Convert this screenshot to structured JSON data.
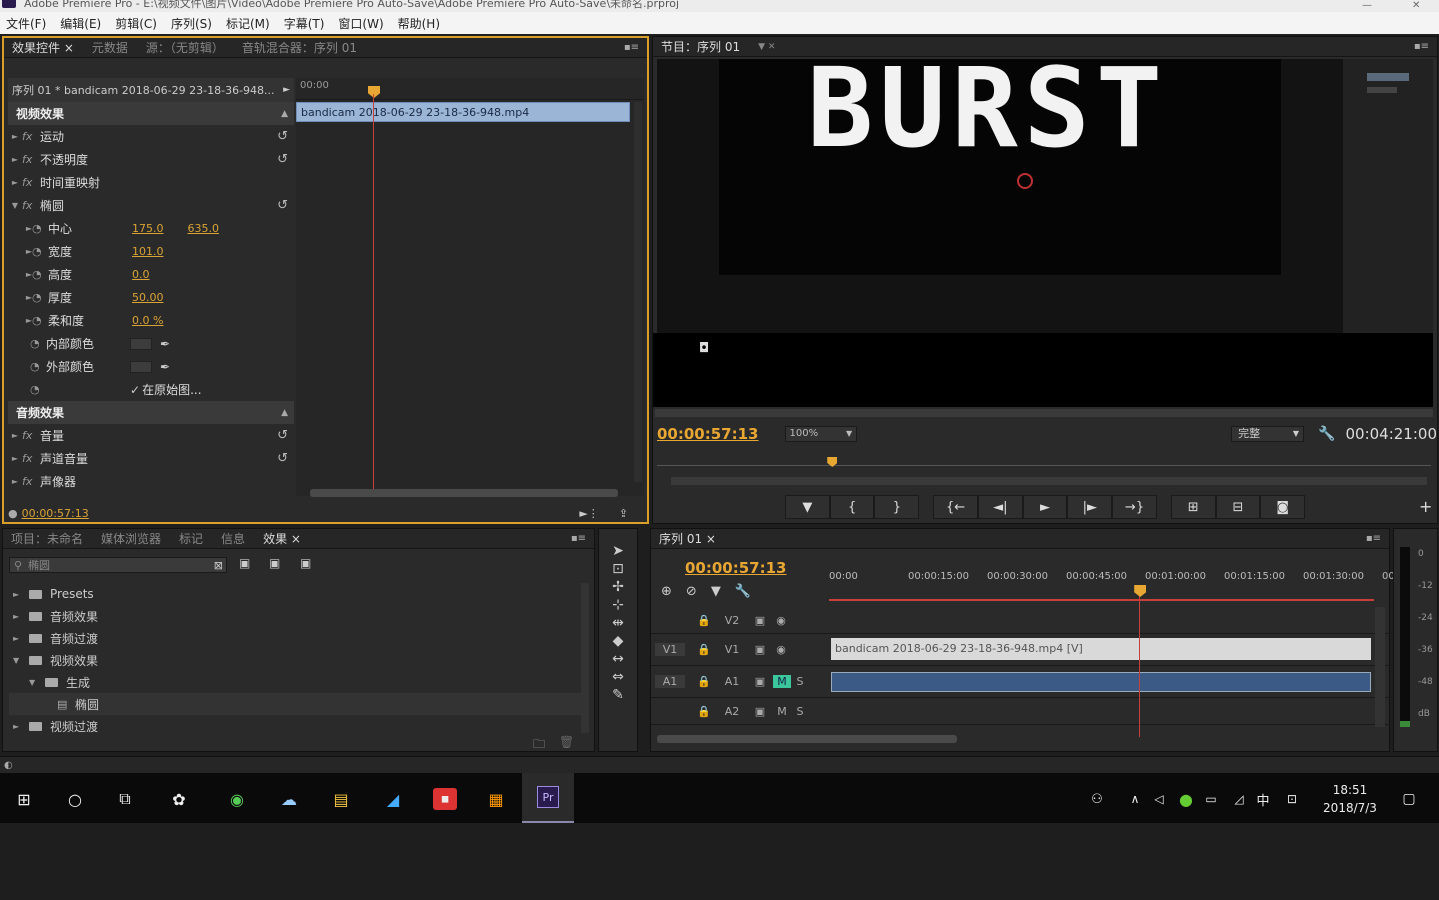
{
  "window": {
    "title": "Adobe Premiere Pro - E:\\视频文件\\图片\\Video\\Adobe Premiere Pro Auto-Save\\Adobe Premiere Pro Auto-Save\\未命名.prproj"
  },
  "menu": [
    "文件(F)",
    "编辑(E)",
    "剪辑(C)",
    "序列(S)",
    "标记(M)",
    "字幕(T)",
    "窗口(W)",
    "帮助(H)"
  ],
  "effect_controls": {
    "tabs": [
      "效果控件 ×",
      "元数据",
      "源：（无剪辑）",
      "音轨混合器：序列 01"
    ],
    "sequence_label": "序列 01 * bandicam 2018-06-29 23-18-36-948...",
    "timeline_start": "00:00",
    "clip_name": "bandicam 2018-06-29 23-18-36-948.mp4",
    "video_header": "视频效果",
    "video_effects": [
      {
        "name": "运动",
        "prefix": "fx",
        "hasReset": true
      },
      {
        "name": "不透明度",
        "prefix": "fx",
        "hasReset": true
      },
      {
        "name": "时间重映射",
        "prefix": "fx",
        "hasReset": false
      },
      {
        "name": "椭圆",
        "prefix": "fx",
        "hasReset": true,
        "expanded": true
      }
    ],
    "ellipse_props": [
      {
        "name": "中心",
        "v1": "175.0",
        "v2": "635.0"
      },
      {
        "name": "宽度",
        "v1": "101.0"
      },
      {
        "name": "高度",
        "v1": "0.0"
      },
      {
        "name": "厚度",
        "v1": "50.00"
      },
      {
        "name": "柔和度",
        "v1": "0.0 %"
      },
      {
        "name": "内部颜色",
        "color": true
      },
      {
        "name": "外部颜色",
        "color": true
      },
      {
        "name": "",
        "check": "在原始图..."
      }
    ],
    "audio_header": "音频效果",
    "audio_effects": [
      {
        "name": "音量",
        "hasReset": true
      },
      {
        "name": "声道音量",
        "hasReset": true
      },
      {
        "name": "声像器",
        "hasReset": false
      }
    ],
    "current_time": "00:00:57:13"
  },
  "program_monitor": {
    "tab": "节目：序列 01",
    "burst_text": "BURST",
    "timecode": "00:00:57:13",
    "zoom": "100%",
    "quality": "完整",
    "duration": "00:04:21:00",
    "playhead_fraction": 0.22,
    "transport": [
      "▼",
      "{",
      "}",
      "{←",
      "◄|",
      "►",
      "|►",
      "→}",
      "⊞",
      "⊟",
      "◙"
    ]
  },
  "effects_panel": {
    "tabs": [
      "项目：未命名",
      "媒体浏览器",
      "标记",
      "信息",
      "效果 ×"
    ],
    "search_placeholder": "椭圆",
    "tree": [
      {
        "label": "Presets",
        "depth": 0,
        "open": false
      },
      {
        "label": "音频效果",
        "depth": 0,
        "open": false
      },
      {
        "label": "音频过渡",
        "depth": 0,
        "open": false
      },
      {
        "label": "视频效果",
        "depth": 0,
        "open": true
      },
      {
        "label": "生成",
        "depth": 1,
        "open": true
      },
      {
        "label": "椭圆",
        "depth": 2,
        "item": true
      },
      {
        "label": "视频过渡",
        "depth": 0,
        "open": false
      }
    ]
  },
  "timeline": {
    "tab": "序列 01 ×",
    "timecode": "00:00:57:13",
    "ruler": [
      "00:00",
      "00:00:15:00",
      "00:00:30:00",
      "00:00:45:00",
      "00:01:00:00",
      "00:01:15:00",
      "00:01:30:00",
      "00:"
    ],
    "tracks": [
      {
        "src": "",
        "name": "V2",
        "type": "video"
      },
      {
        "src": "V1",
        "name": "V1",
        "type": "video",
        "clip": "bandicam 2018-06-29 23-18-36-948.mp4 [V]"
      },
      {
        "src": "A1",
        "name": "A1",
        "type": "audio",
        "mute_on": true
      },
      {
        "src": "",
        "name": "A2",
        "type": "audio"
      }
    ],
    "playhead_fraction": 0.56
  },
  "audio_meter": {
    "ticks": [
      "0",
      "-12",
      "-24",
      "-36",
      "-48",
      "dB"
    ]
  },
  "taskbar": {
    "time": "18:51",
    "date": "2018/7/3",
    "ime": "中"
  }
}
